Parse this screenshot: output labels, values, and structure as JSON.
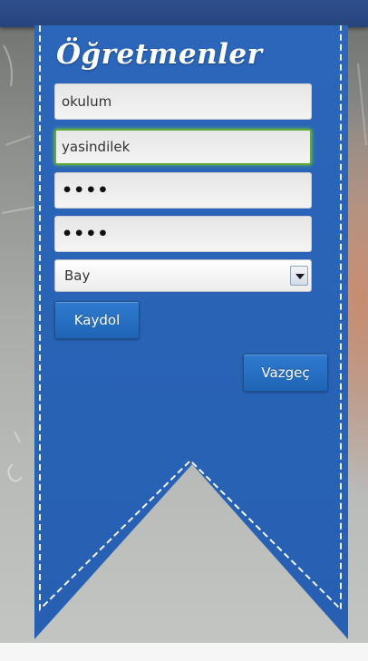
{
  "form": {
    "title": "Öğretmenler",
    "school_value": "okulum",
    "username_value": "yasindilek",
    "password_value": "••••",
    "password_confirm_value": "••••",
    "gender_selected": "Bay",
    "register_label": "Kaydol",
    "cancel_label": "Vazgeç"
  },
  "colors": {
    "ribbon": "#2a65b8",
    "topbar": "#2b4a86",
    "button": "#1f64b6",
    "focus_border": "#5fa83a"
  },
  "icons": {
    "dropdown": "triangle-down"
  }
}
